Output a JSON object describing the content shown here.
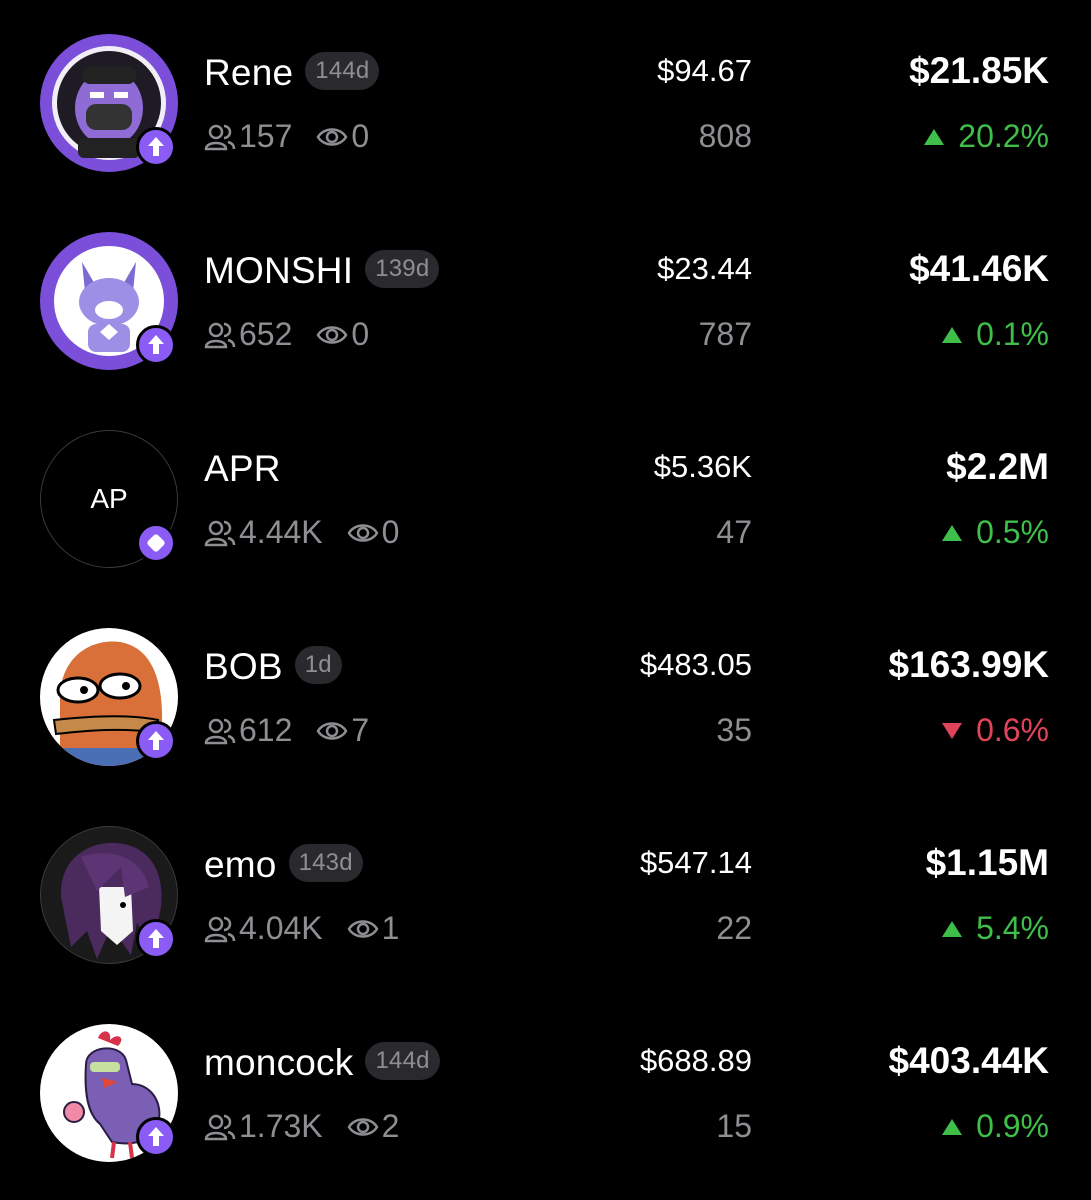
{
  "colors": {
    "up": "#3fbf4a",
    "down": "#e0445a",
    "badge": "#8a5cf5",
    "muted": "#8e8e93"
  },
  "tokens": [
    {
      "name": "Rene",
      "age": "144d",
      "members": "157",
      "views": "0",
      "price": "$94.67",
      "holders": "808",
      "mcap": "$21.85K",
      "direction": "up",
      "change": "20.2%",
      "avatar_icon": "rene-bulldog-avatar",
      "badge_icon": "launch-arrow-icon"
    },
    {
      "name": "MONSHI",
      "age": "139d",
      "members": "652",
      "views": "0",
      "price": "$23.44",
      "holders": "787",
      "mcap": "$41.46K",
      "direction": "up",
      "change": "0.1%",
      "avatar_icon": "monshi-fox-avatar",
      "badge_icon": "launch-arrow-icon"
    },
    {
      "name": "APR",
      "age": "",
      "members": "4.44K",
      "views": "0",
      "price": "$5.36K",
      "holders": "47",
      "mcap": "$2.2M",
      "direction": "up",
      "change": "0.5%",
      "avatar_text": "AP",
      "avatar_icon": "initials-avatar",
      "badge_icon": "diamond-icon"
    },
    {
      "name": "BOB",
      "age": "1d",
      "members": "612",
      "views": "7",
      "price": "$483.05",
      "holders": "35",
      "mcap": "$163.99K",
      "direction": "down",
      "change": "0.6%",
      "avatar_icon": "bob-fish-avatar",
      "badge_icon": "launch-arrow-icon"
    },
    {
      "name": "emo",
      "age": "143d",
      "members": "4.04K",
      "views": "1",
      "price": "$547.14",
      "holders": "22",
      "mcap": "$1.15M",
      "direction": "up",
      "change": "5.4%",
      "avatar_icon": "emo-hair-avatar",
      "badge_icon": "launch-arrow-icon"
    },
    {
      "name": "moncock",
      "age": "144d",
      "members": "1.73K",
      "views": "2",
      "price": "$688.89",
      "holders": "15",
      "mcap": "$403.44K",
      "direction": "up",
      "change": "0.9%",
      "avatar_icon": "moncock-rooster-avatar",
      "badge_icon": "launch-arrow-icon"
    }
  ]
}
